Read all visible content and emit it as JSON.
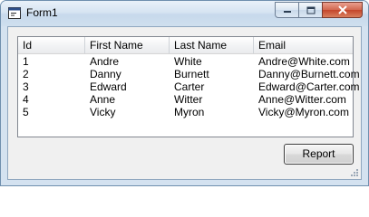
{
  "window": {
    "title": "Form1",
    "icons": {
      "app": "form-icon",
      "minimize": "minimize-icon",
      "maximize": "maximize-icon",
      "close": "close-icon"
    }
  },
  "listview": {
    "columns": [
      "Id",
      "First Name",
      "Last Name",
      "Email"
    ],
    "rows": [
      [
        "1",
        "Andre",
        "White",
        "Andre@White.com"
      ],
      [
        "2",
        "Danny",
        "Burnett",
        "Danny@Burnett.com"
      ],
      [
        "3",
        "Edward",
        "Carter",
        "Edward@Carter.com"
      ],
      [
        "4",
        "Anne",
        "Witter",
        "Anne@Witter.com"
      ],
      [
        "5",
        "Vicky",
        "Myron",
        "Vicky@Myron.com"
      ]
    ]
  },
  "buttons": {
    "report_label": "Report"
  }
}
